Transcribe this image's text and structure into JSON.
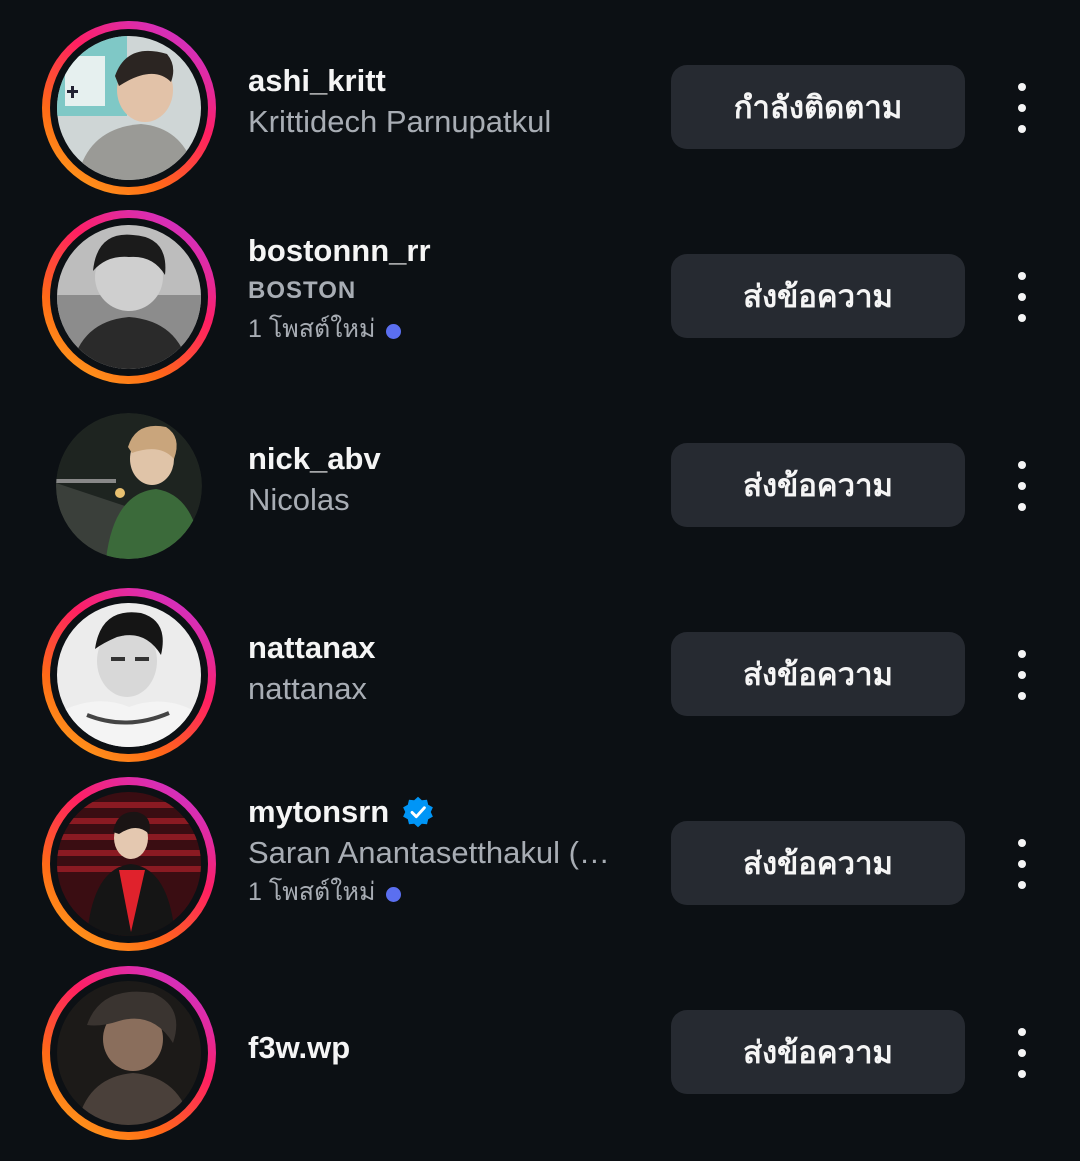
{
  "accounts": [
    {
      "username": "ashi_kritt",
      "full_name": "Krittidech Parnupatkul",
      "new_posts": "",
      "verified": false,
      "has_story_ring": true,
      "action_label": "กำลังติดตาม"
    },
    {
      "username": "bostonnn_rr",
      "full_name": "BOSTON",
      "new_posts": "1 โพสต์ใหม่",
      "verified": false,
      "has_story_ring": true,
      "action_label": "ส่งข้อความ"
    },
    {
      "username": "nick_abv",
      "full_name": "Nicolas",
      "new_posts": "",
      "verified": false,
      "has_story_ring": false,
      "action_label": "ส่งข้อความ"
    },
    {
      "username": "nattanax",
      "full_name": "nattanax",
      "new_posts": "",
      "verified": false,
      "has_story_ring": true,
      "action_label": "ส่งข้อความ"
    },
    {
      "username": "mytonsrn",
      "full_name": "Saran Anantasetthakul (…",
      "new_posts": "1 โพสต์ใหม่",
      "verified": true,
      "has_story_ring": true,
      "action_label": "ส่งข้อความ"
    },
    {
      "username": "f3w.wp",
      "full_name": "",
      "new_posts": "",
      "verified": false,
      "has_story_ring": true,
      "action_label": "ส่งข้อความ"
    }
  ],
  "colors": {
    "background": "#0c1014",
    "button": "#262a31",
    "secondary_text": "#a8adb4",
    "new_post_dot": "#5b6ff0",
    "verified_badge": "#0095f6"
  },
  "icons": {
    "more": "more-options-icon",
    "verified": "verified-badge-icon",
    "new_post": "new-post-dot-icon"
  }
}
